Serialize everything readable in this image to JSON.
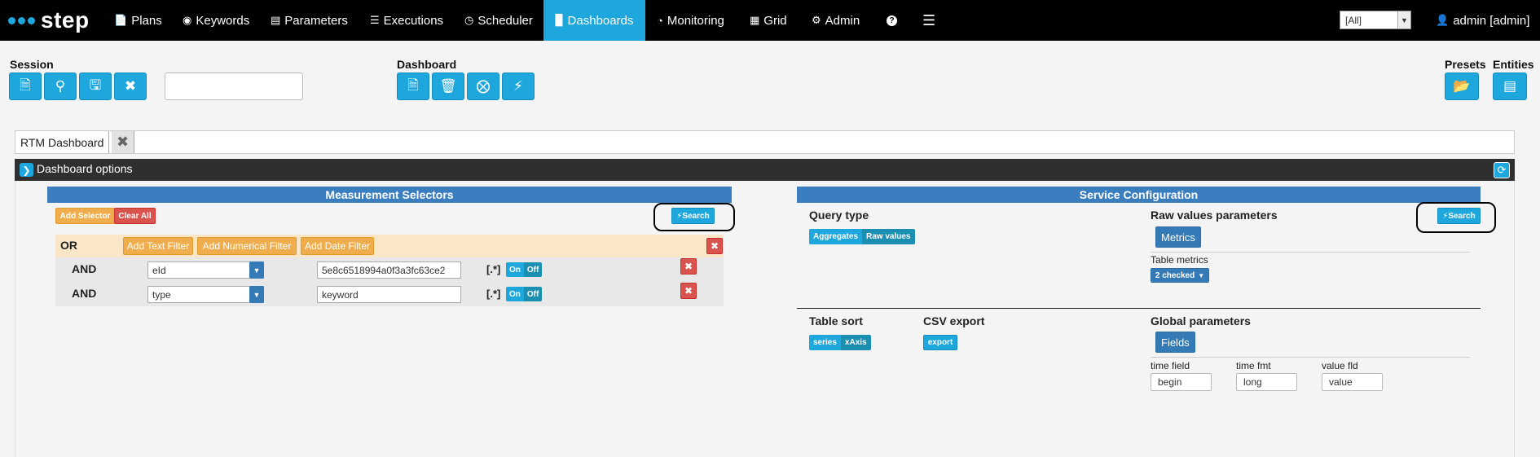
{
  "navbar": {
    "logo_text": "step",
    "items": [
      {
        "label": "Plans",
        "icon": "file-icon"
      },
      {
        "label": "Keywords",
        "icon": "target-icon"
      },
      {
        "label": "Parameters",
        "icon": "list-icon"
      },
      {
        "label": "Executions",
        "icon": "tasks-icon"
      },
      {
        "label": "Scheduler",
        "icon": "clock-icon"
      },
      {
        "label": "Dashboards",
        "icon": "chart-icon"
      },
      {
        "label": "Monitoring",
        "icon": "dashboard-icon"
      },
      {
        "label": "Grid",
        "icon": "grid-icon"
      },
      {
        "label": "Admin",
        "icon": "gear-icon"
      }
    ],
    "active_item": "Dashboards",
    "tenant_select": "[All]",
    "user": "admin [admin]"
  },
  "toolbar": {
    "session_label": "Session",
    "dashboard_label": "Dashboard",
    "presets_label": "Presets",
    "entities_label": "Entities",
    "session_input_value": ""
  },
  "tabs": [
    {
      "label": "RTM Dashboard"
    }
  ],
  "options": {
    "title": "Dashboard options"
  },
  "measurement": {
    "title": "Measurement Selectors",
    "add_selector": "Add Selector",
    "clear_all": "Clear All",
    "search": "Search",
    "or_label": "OR",
    "add_text_filter": "Add Text Filter",
    "add_numerical_filter": "Add Numerical Filter",
    "add_date_filter": "Add Date Filter",
    "filters": [
      {
        "op": "AND",
        "field": "eId",
        "value": "5e8c6518994a0f3a3fc63ce2",
        "regex": "[.*]",
        "on": "On",
        "off": "Off"
      },
      {
        "op": "AND",
        "field": "type",
        "value": "keyword",
        "regex": "[.*]",
        "on": "On",
        "off": "Off"
      }
    ]
  },
  "service": {
    "title": "Service Configuration",
    "query_type_label": "Query type",
    "query_type_options": [
      "Aggregates",
      "Raw values"
    ],
    "raw_values_label": "Raw values parameters",
    "search": "Search",
    "metrics_button": "Metrics",
    "table_metrics_label": "Table metrics",
    "table_metrics_value": "2 checked",
    "table_sort_label": "Table sort",
    "table_sort_options": [
      "series",
      "xAxis"
    ],
    "csv_export_label": "CSV export",
    "csv_export_button": "export",
    "global_params_label": "Global parameters",
    "fields_button": "Fields",
    "time_field_label": "time field",
    "time_field_value": "begin",
    "time_fmt_label": "time fmt",
    "time_fmt_value": "long",
    "value_fld_label": "value fld",
    "value_fld_value": "value"
  },
  "colors": {
    "accent": "#1ea7dc",
    "navbar_bg": "#000000",
    "panel_header": "#3a7ebf",
    "danger": "#d9534f",
    "warning": "#f0ad4e"
  }
}
